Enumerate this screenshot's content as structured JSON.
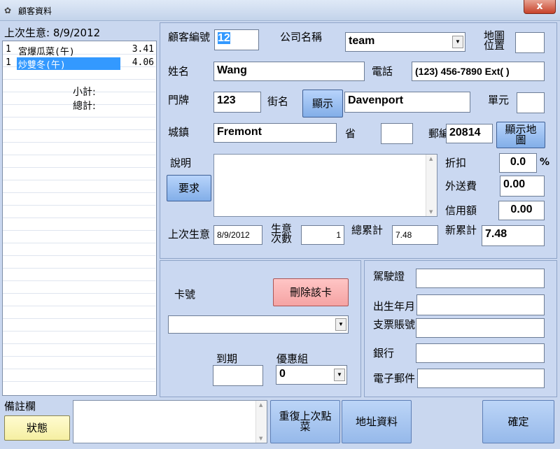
{
  "window": {
    "title": "顧客資料",
    "close_label": "x"
  },
  "order": {
    "header": "上次生意: 8/9/2012",
    "items": [
      {
        "qty": "1",
        "name": "宮爆瓜菜(午)",
        "price": "3.41"
      },
      {
        "qty": "1",
        "name": "炒雙冬(午)",
        "price": "4.06"
      }
    ],
    "subtotal_label": "小計:",
    "total_label": "總計:"
  },
  "customer": {
    "id_label": "顧客編號",
    "id_value": "12",
    "company_label": "公司名稱",
    "company_value": "team",
    "map_pos_label": "地圖位置",
    "name_label": "姓名",
    "name_value": "Wang",
    "phone_label": "電話",
    "phone_value": "(123) 456-7890 Ext(    )",
    "door_label": "門牌",
    "door_value": "123",
    "street_label": "街名",
    "show_label": "顯示",
    "street_value": "Davenport",
    "unit_label": "單元",
    "city_label": "城鎮",
    "city_value": "Fremont",
    "province_label": "省",
    "zip_label": "郵編",
    "zip_value": "20814",
    "show_map_label": "顯示地圖",
    "desc_label": "說明",
    "request_label": "要求",
    "discount_label": "折扣",
    "discount_value": "0.0",
    "percent": "%",
    "delivery_label": "外送費",
    "delivery_value": "0.00",
    "credit_label": "信用額",
    "credit_value": "0.00",
    "last_biz_label": "上次生意",
    "last_biz_value": "8/9/2012",
    "biz_count_label": "生意次數",
    "biz_count_value": "1",
    "total_acc_label": "總累計",
    "total_acc_value": "7.48",
    "new_acc_label": "新累計",
    "new_acc_value": "7.48"
  },
  "card": {
    "card_no_label": "卡號",
    "delete_label": "刪除該卡",
    "expiry_label": "到期",
    "promo_label": "優惠組",
    "promo_value": "0"
  },
  "extra": {
    "license_label": "駕駛證",
    "birth_label": "出生年月",
    "check_label": "支票賬號",
    "bank_label": "銀行",
    "email_label": "電子郵件"
  },
  "bottom": {
    "notes_label": "備註欄",
    "status_label": "狀態",
    "repeat_label": "重復上次點菜",
    "address_label": "地址資料",
    "ok_label": "確定"
  }
}
